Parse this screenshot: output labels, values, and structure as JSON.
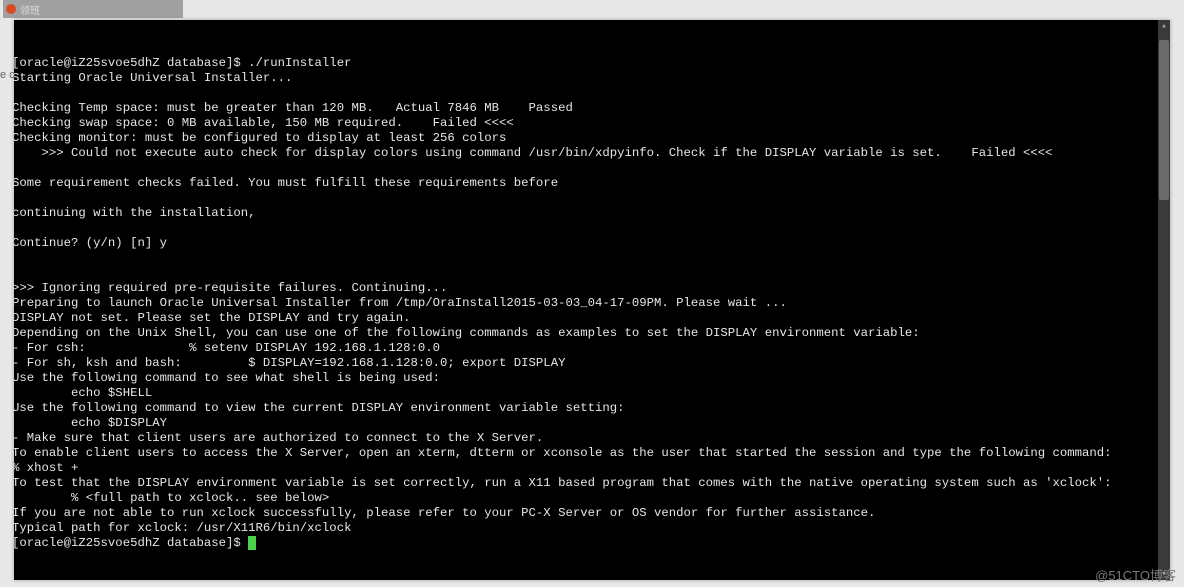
{
  "browser_tab": {
    "label": "领班"
  },
  "left_margin_text": "e c",
  "watermark": "@51CTO博客",
  "terminal": {
    "prompt_user": "oracle@iZ25svoe5dhZ",
    "prompt_dir": "database",
    "lines": [
      "[oracle@iZ25svoe5dhZ database]$ ./runInstaller",
      "Starting Oracle Universal Installer...",
      "",
      "Checking Temp space: must be greater than 120 MB.   Actual 7846 MB    Passed",
      "Checking swap space: 0 MB available, 150 MB required.    Failed <<<<",
      "Checking monitor: must be configured to display at least 256 colors",
      "    >>> Could not execute auto check for display colors using command /usr/bin/xdpyinfo. Check if the DISPLAY variable is set.    Failed <<<<",
      "",
      "Some requirement checks failed. You must fulfill these requirements before",
      "",
      "continuing with the installation,",
      "",
      "Continue? (y/n) [n] y",
      "",
      "",
      ">>> Ignoring required pre-requisite failures. Continuing...",
      "Preparing to launch Oracle Universal Installer from /tmp/OraInstall2015-03-03_04-17-09PM. Please wait ...",
      "DISPLAY not set. Please set the DISPLAY and try again.",
      "Depending on the Unix Shell, you can use one of the following commands as examples to set the DISPLAY environment variable:",
      "- For csh:              % setenv DISPLAY 192.168.1.128:0.0",
      "- For sh, ksh and bash:         $ DISPLAY=192.168.1.128:0.0; export DISPLAY",
      "Use the following command to see what shell is being used:",
      "        echo $SHELL",
      "Use the following command to view the current DISPLAY environment variable setting:",
      "        echo $DISPLAY",
      "- Make sure that client users are authorized to connect to the X Server.",
      "To enable client users to access the X Server, open an xterm, dtterm or xconsole as the user that started the session and type the following command:",
      "% xhost +",
      "To test that the DISPLAY environment variable is set correctly, run a X11 based program that comes with the native operating system such as 'xclock':",
      "        % <full path to xclock.. see below>",
      "If you are not able to run xclock successfully, please refer to your PC-X Server or OS vendor for further assistance.",
      "Typical path for xclock: /usr/X11R6/bin/xclock"
    ],
    "final_prompt": "[oracle@iZ25svoe5dhZ database]$ "
  }
}
